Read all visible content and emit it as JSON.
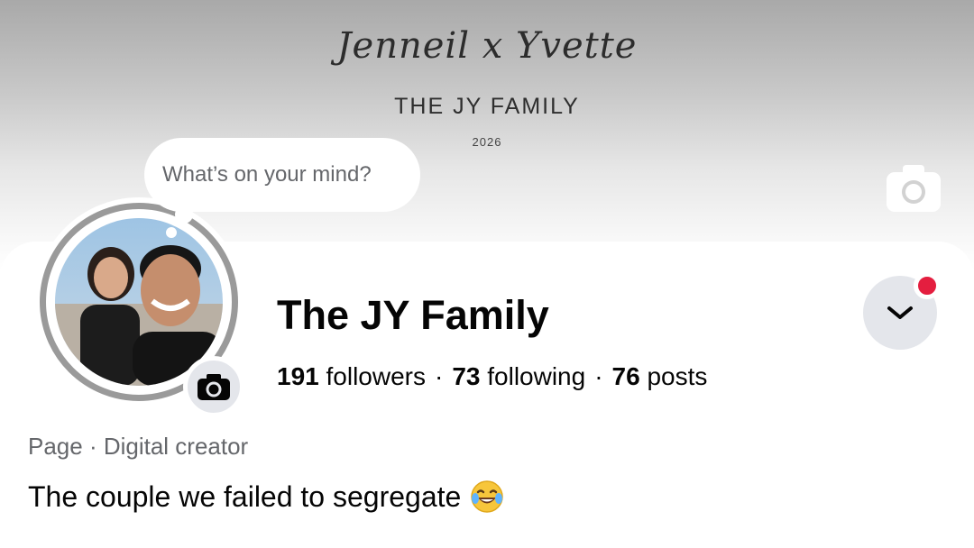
{
  "cover": {
    "script_text": "Jenneil x Yvette",
    "family_text": "THE JY FAMILY",
    "year_text": "2026",
    "camera_icon": "camera-icon"
  },
  "status_bubble": {
    "placeholder": "What’s on your mind?"
  },
  "profile": {
    "name": "The JY Family",
    "stats": {
      "followers_count": "191",
      "followers_label": "followers",
      "following_count": "73",
      "following_label": "following",
      "posts_count": "76",
      "posts_label": "posts",
      "separator": "·"
    },
    "category": "Page · Digital creator",
    "bio": "The couple we failed to segregate",
    "bio_emoji": "face-with-tears-of-joy"
  },
  "colors": {
    "accent_red": "#e41e3f",
    "button_gray": "#e4e6eb",
    "secondary_text": "#65676b"
  }
}
